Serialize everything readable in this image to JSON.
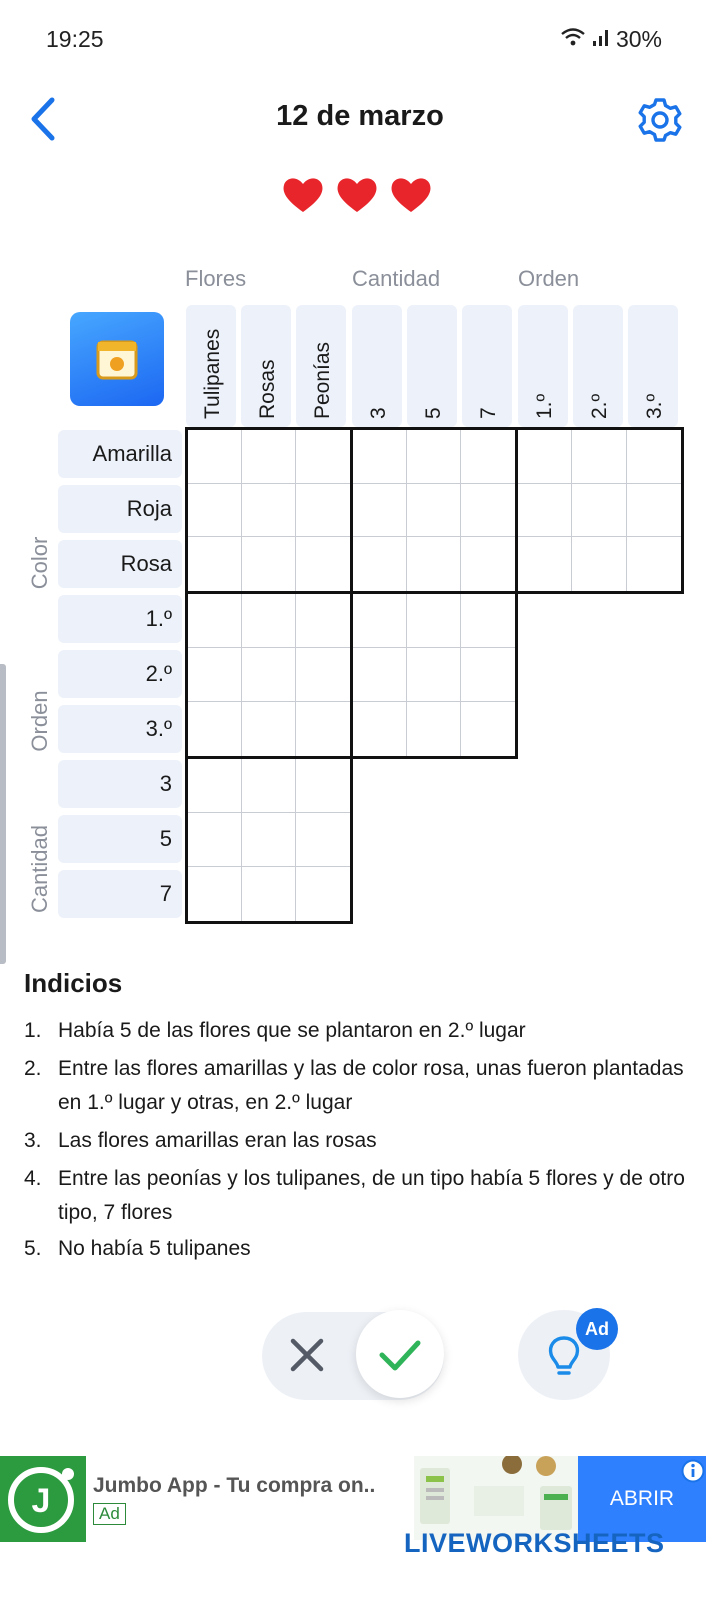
{
  "status_bar": {
    "time": "19:25",
    "battery": "30%"
  },
  "header": {
    "title": "12 de marzo"
  },
  "lives": {
    "count": 3
  },
  "grid": {
    "column_categories": [
      "Flores",
      "Cantidad",
      "Orden"
    ],
    "column_headers": [
      "Tulipanes",
      "Rosas",
      "Peonías",
      "3",
      "5",
      "7",
      "1.º",
      "2.º",
      "3.º"
    ],
    "row_categories": [
      "Color",
      "Orden",
      "Cantidad"
    ],
    "row_headers": [
      "Amarilla",
      "Roja",
      "Rosa",
      "1.º",
      "2.º",
      "3.º",
      "3",
      "5",
      "7"
    ]
  },
  "clues": {
    "title": "Indicios",
    "items": [
      {
        "num": "1.",
        "text": "Había 5 de las flores que se plantaron en 2.º lugar"
      },
      {
        "num": "2.",
        "text": "Entre las flores amarillas y las de color rosa, unas fueron plantadas en 1.º lugar y otras, en 2.º lugar"
      },
      {
        "num": "3.",
        "text": "Las flores amarillas eran las rosas"
      },
      {
        "num": "4.",
        "text": "Entre las peonías y los tulipanes, de un tipo había 5 flores y de otro tipo, 7 flores"
      },
      {
        "num": "5.",
        "text": "No había 5 tulipanes"
      }
    ]
  },
  "controls": {
    "hint_badge": "Ad"
  },
  "ad": {
    "title": "Jumbo App - Tu compra on..",
    "tag": "Ad",
    "cta": "ABRIR",
    "logo_letter": "J"
  },
  "watermark": "LIVEWORKSHEETS",
  "colors": {
    "accent": "#1a73e8",
    "heart": "#e8252b",
    "check": "#2fb45a"
  }
}
